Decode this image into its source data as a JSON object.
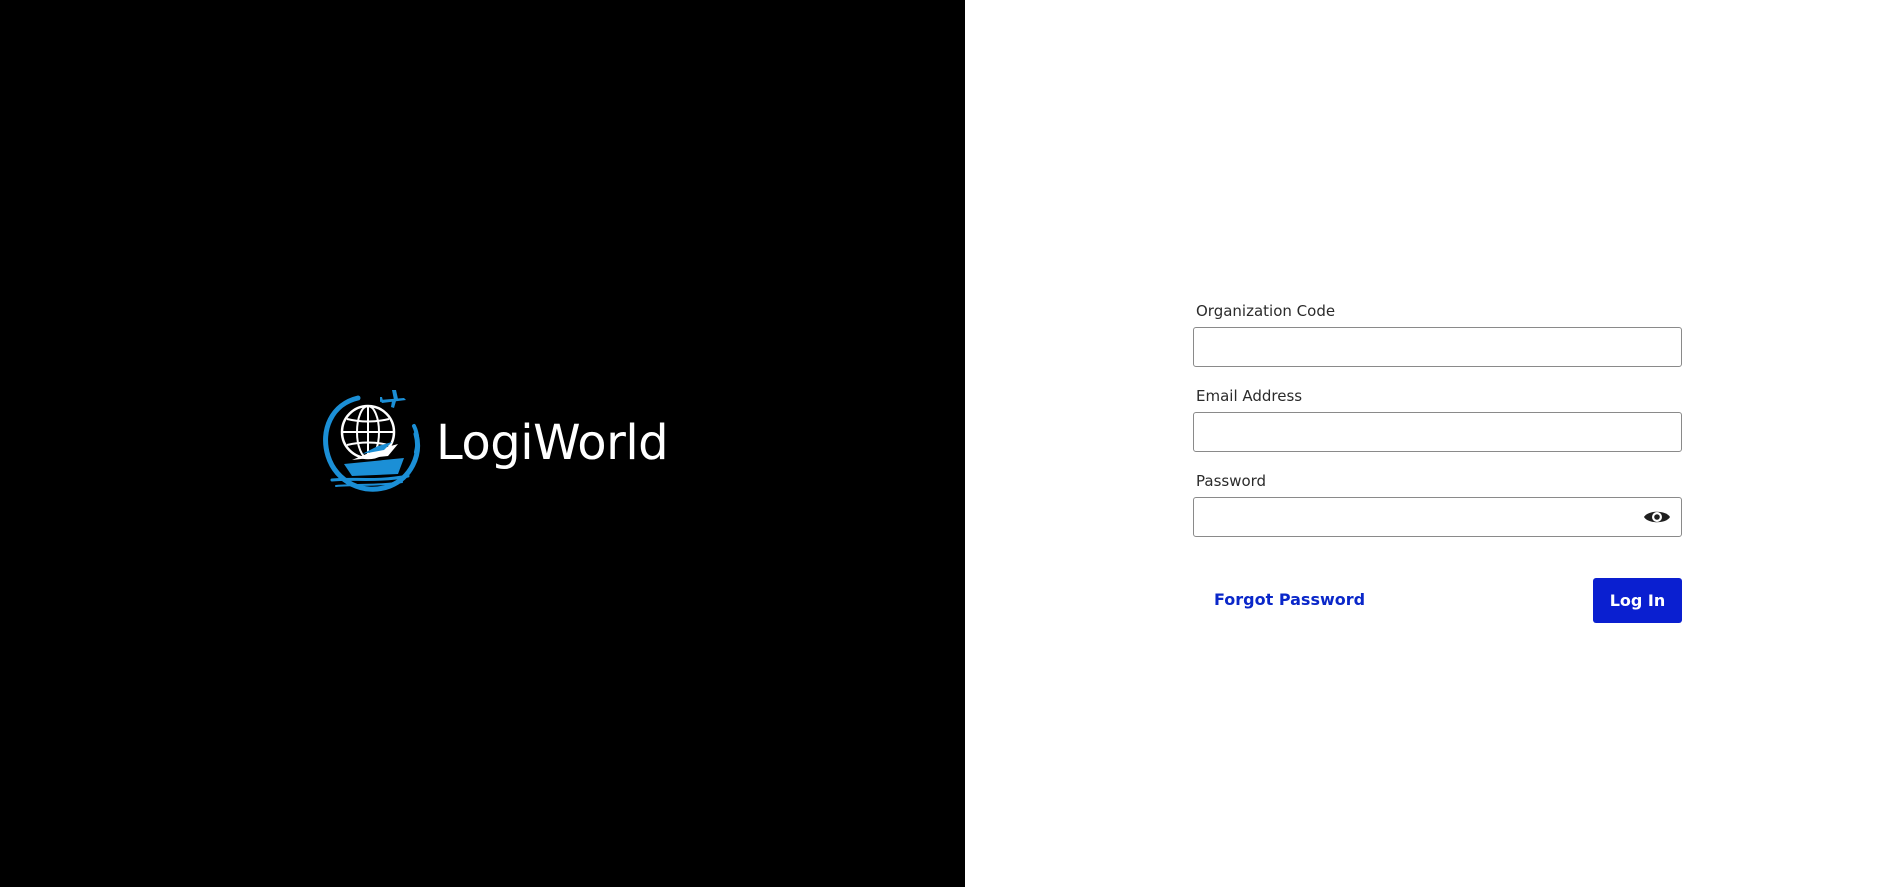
{
  "brand": {
    "name": "LogiWorld",
    "logo_icon": "globe-ship-plane-icon",
    "panel_color": "#000000",
    "accent_color": "#1b8fd6"
  },
  "form": {
    "organization_code": {
      "label": "Organization Code",
      "value": ""
    },
    "email": {
      "label": "Email Address",
      "value": ""
    },
    "password": {
      "label": "Password",
      "value": "",
      "toggle_icon": "eye-icon"
    },
    "forgot_password_label": "Forgot Password",
    "login_label": "Log In",
    "primary_color": "#0a1fd0"
  }
}
